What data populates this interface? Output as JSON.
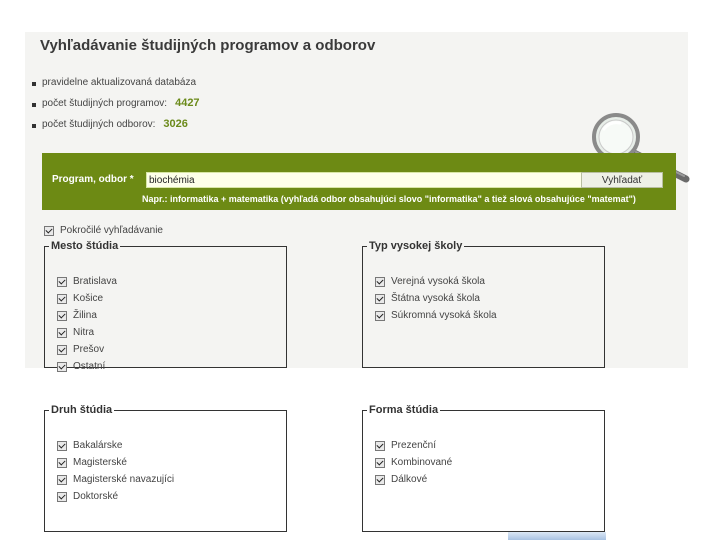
{
  "page": {
    "title": "Vyhľadávanie študijných programov a odborov"
  },
  "stats": [
    {
      "label": "pravidelne aktualizovaná databáza",
      "value": ""
    },
    {
      "label": "počet študijných programov:",
      "value": "4427"
    },
    {
      "label": "počet študijných odborov:",
      "value": "3026"
    }
  ],
  "search": {
    "label": "Program, odbor *",
    "value": "biochémia",
    "placeholder": "",
    "button": "Vyhľadať",
    "hint": "Napr.: informatika + matematika (vyhľadá odbor obsahujúci slovo \"informatika\" a tiež slová obsahujúce \"matemat\")"
  },
  "advanced": {
    "label": "Pokročilé vyhľadávanie",
    "checked": true
  },
  "groups": {
    "mesto": {
      "legend": "Mesto štúdia",
      "items": [
        "Bratislava",
        "Košice",
        "Žilina",
        "Nitra",
        "Prešov",
        "Ostatní"
      ]
    },
    "typ": {
      "legend": "Typ vysokej školy",
      "items": [
        "Verejná vysoká škola",
        "Štátna vysoká škola",
        "Súkromná vysoká škola"
      ]
    },
    "druh": {
      "legend": "Druh štúdia",
      "items": [
        "Bakalárske",
        "Magisterské",
        "Magisterské navazujíci",
        "Doktorské"
      ]
    },
    "forma": {
      "legend": "Forma štúdia",
      "items": [
        "Prezenční",
        "Kombinované",
        "Dálkové"
      ]
    }
  },
  "colors": {
    "search_bar": "#6d8a14",
    "stat_number": "#6b8a1a"
  },
  "icons": {
    "magnifier": "magnifying-glass-icon",
    "checkbox": "checkbox-checked-icon"
  }
}
